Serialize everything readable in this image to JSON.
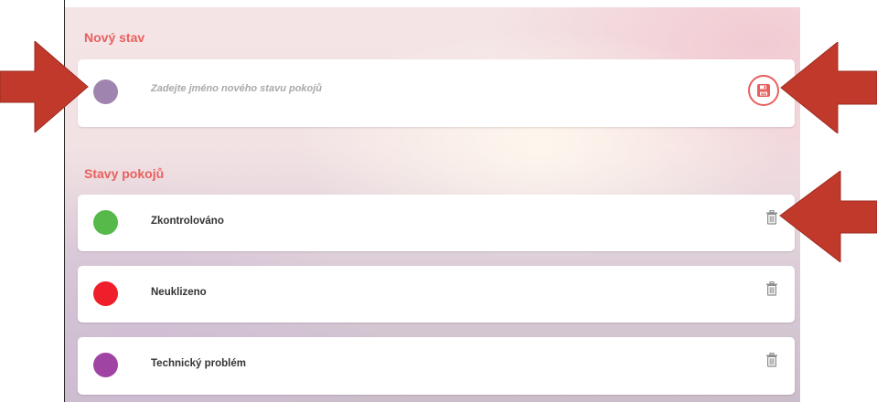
{
  "new_state": {
    "title": "Nový stav",
    "placeholder": "Zadejte jméno nového stavu pokojů",
    "color": "#a084b0",
    "save_icon": "floppy-disk-icon"
  },
  "states": {
    "title": "Stavy pokojů",
    "items": [
      {
        "label": "Zkontrolováno",
        "color": "#56b94a"
      },
      {
        "label": "Neuklizeno",
        "color": "#ee1e2a"
      },
      {
        "label": "Technický problém",
        "color": "#a044a3"
      }
    ],
    "delete_icon": "trash-icon"
  },
  "colors": {
    "accent": "#e8605e",
    "annotation_arrow": "#c0392b"
  }
}
